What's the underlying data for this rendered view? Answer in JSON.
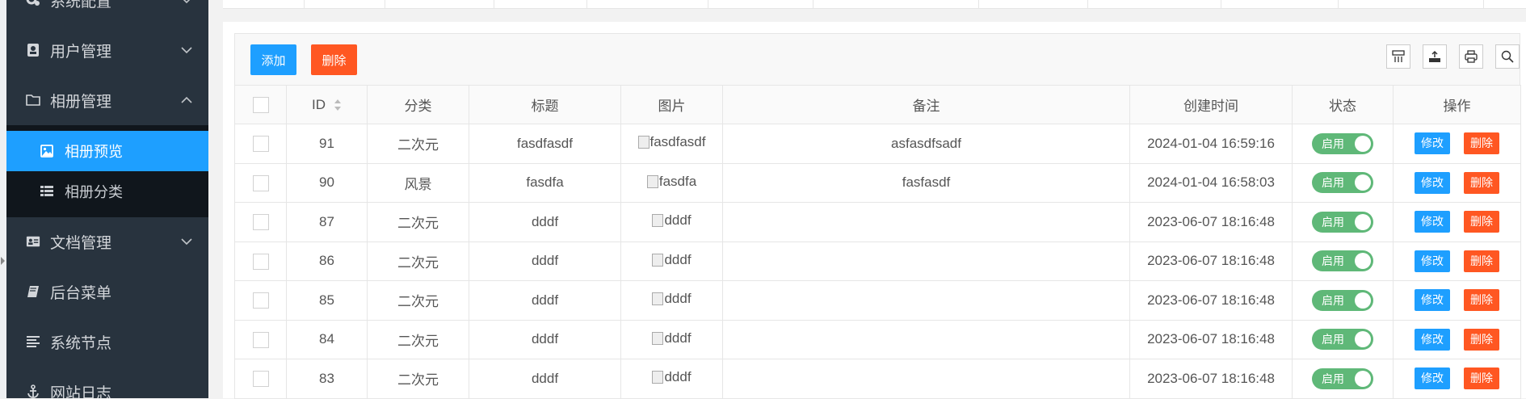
{
  "sidebar": {
    "items": [
      {
        "label": "系统配置",
        "icon": "gears-icon",
        "chevron": "down"
      },
      {
        "label": "用户管理",
        "icon": "user-card-icon",
        "chevron": "down"
      },
      {
        "label": "相册管理",
        "icon": "folder-icon",
        "chevron": "up"
      },
      {
        "label": "文档管理",
        "icon": "id-card-icon",
        "chevron": "down"
      },
      {
        "label": "后台菜单",
        "icon": "book-icon",
        "chevron": "none"
      },
      {
        "label": "系统节点",
        "icon": "list-lines-icon",
        "chevron": "none"
      },
      {
        "label": "网站日志",
        "icon": "anchor-icon",
        "chevron": "none"
      }
    ],
    "sub_items": [
      {
        "label": "相册预览",
        "icon": "image-icon",
        "active": true
      },
      {
        "label": "相册分类",
        "icon": "th-list-icon",
        "active": false
      }
    ]
  },
  "toolbar": {
    "add_label": "添加",
    "delete_label": "删除",
    "tools": [
      "columns-icon",
      "export-icon",
      "print-icon",
      "search-icon"
    ]
  },
  "table": {
    "headers": [
      "ID",
      "分类",
      "标题",
      "图片",
      "备注",
      "创建时间",
      "状态",
      "操作"
    ],
    "status_label": "启用",
    "edit_label": "修改",
    "delete_label": "删除",
    "rows": [
      {
        "id": "91",
        "category": "二次元",
        "title": "fasdfasdf",
        "image_alt": "fasdfasdf",
        "note": "asfasdfsadf",
        "created": "2024-01-04 16:59:16"
      },
      {
        "id": "90",
        "category": "风景",
        "title": "fasdfa",
        "image_alt": "fasdfa",
        "note": "fasfasdf",
        "created": "2024-01-04 16:58:03"
      },
      {
        "id": "87",
        "category": "二次元",
        "title": "dddf",
        "image_alt": "dddf",
        "note": "",
        "created": "2023-06-07 18:16:48"
      },
      {
        "id": "86",
        "category": "二次元",
        "title": "dddf",
        "image_alt": "dddf",
        "note": "",
        "created": "2023-06-07 18:16:48"
      },
      {
        "id": "85",
        "category": "二次元",
        "title": "dddf",
        "image_alt": "dddf",
        "note": "",
        "created": "2023-06-07 18:16:48"
      },
      {
        "id": "84",
        "category": "二次元",
        "title": "dddf",
        "image_alt": "dddf",
        "note": "",
        "created": "2023-06-07 18:16:48"
      },
      {
        "id": "83",
        "category": "二次元",
        "title": "dddf",
        "image_alt": "dddf",
        "note": "",
        "created": "2023-06-07 18:16:48"
      }
    ]
  },
  "colors": {
    "sidebar_bg": "#28333e",
    "submenu_bg": "#10161c",
    "active": "#1e9fff",
    "danger": "#ff5722",
    "switch_on": "#5fb878"
  }
}
